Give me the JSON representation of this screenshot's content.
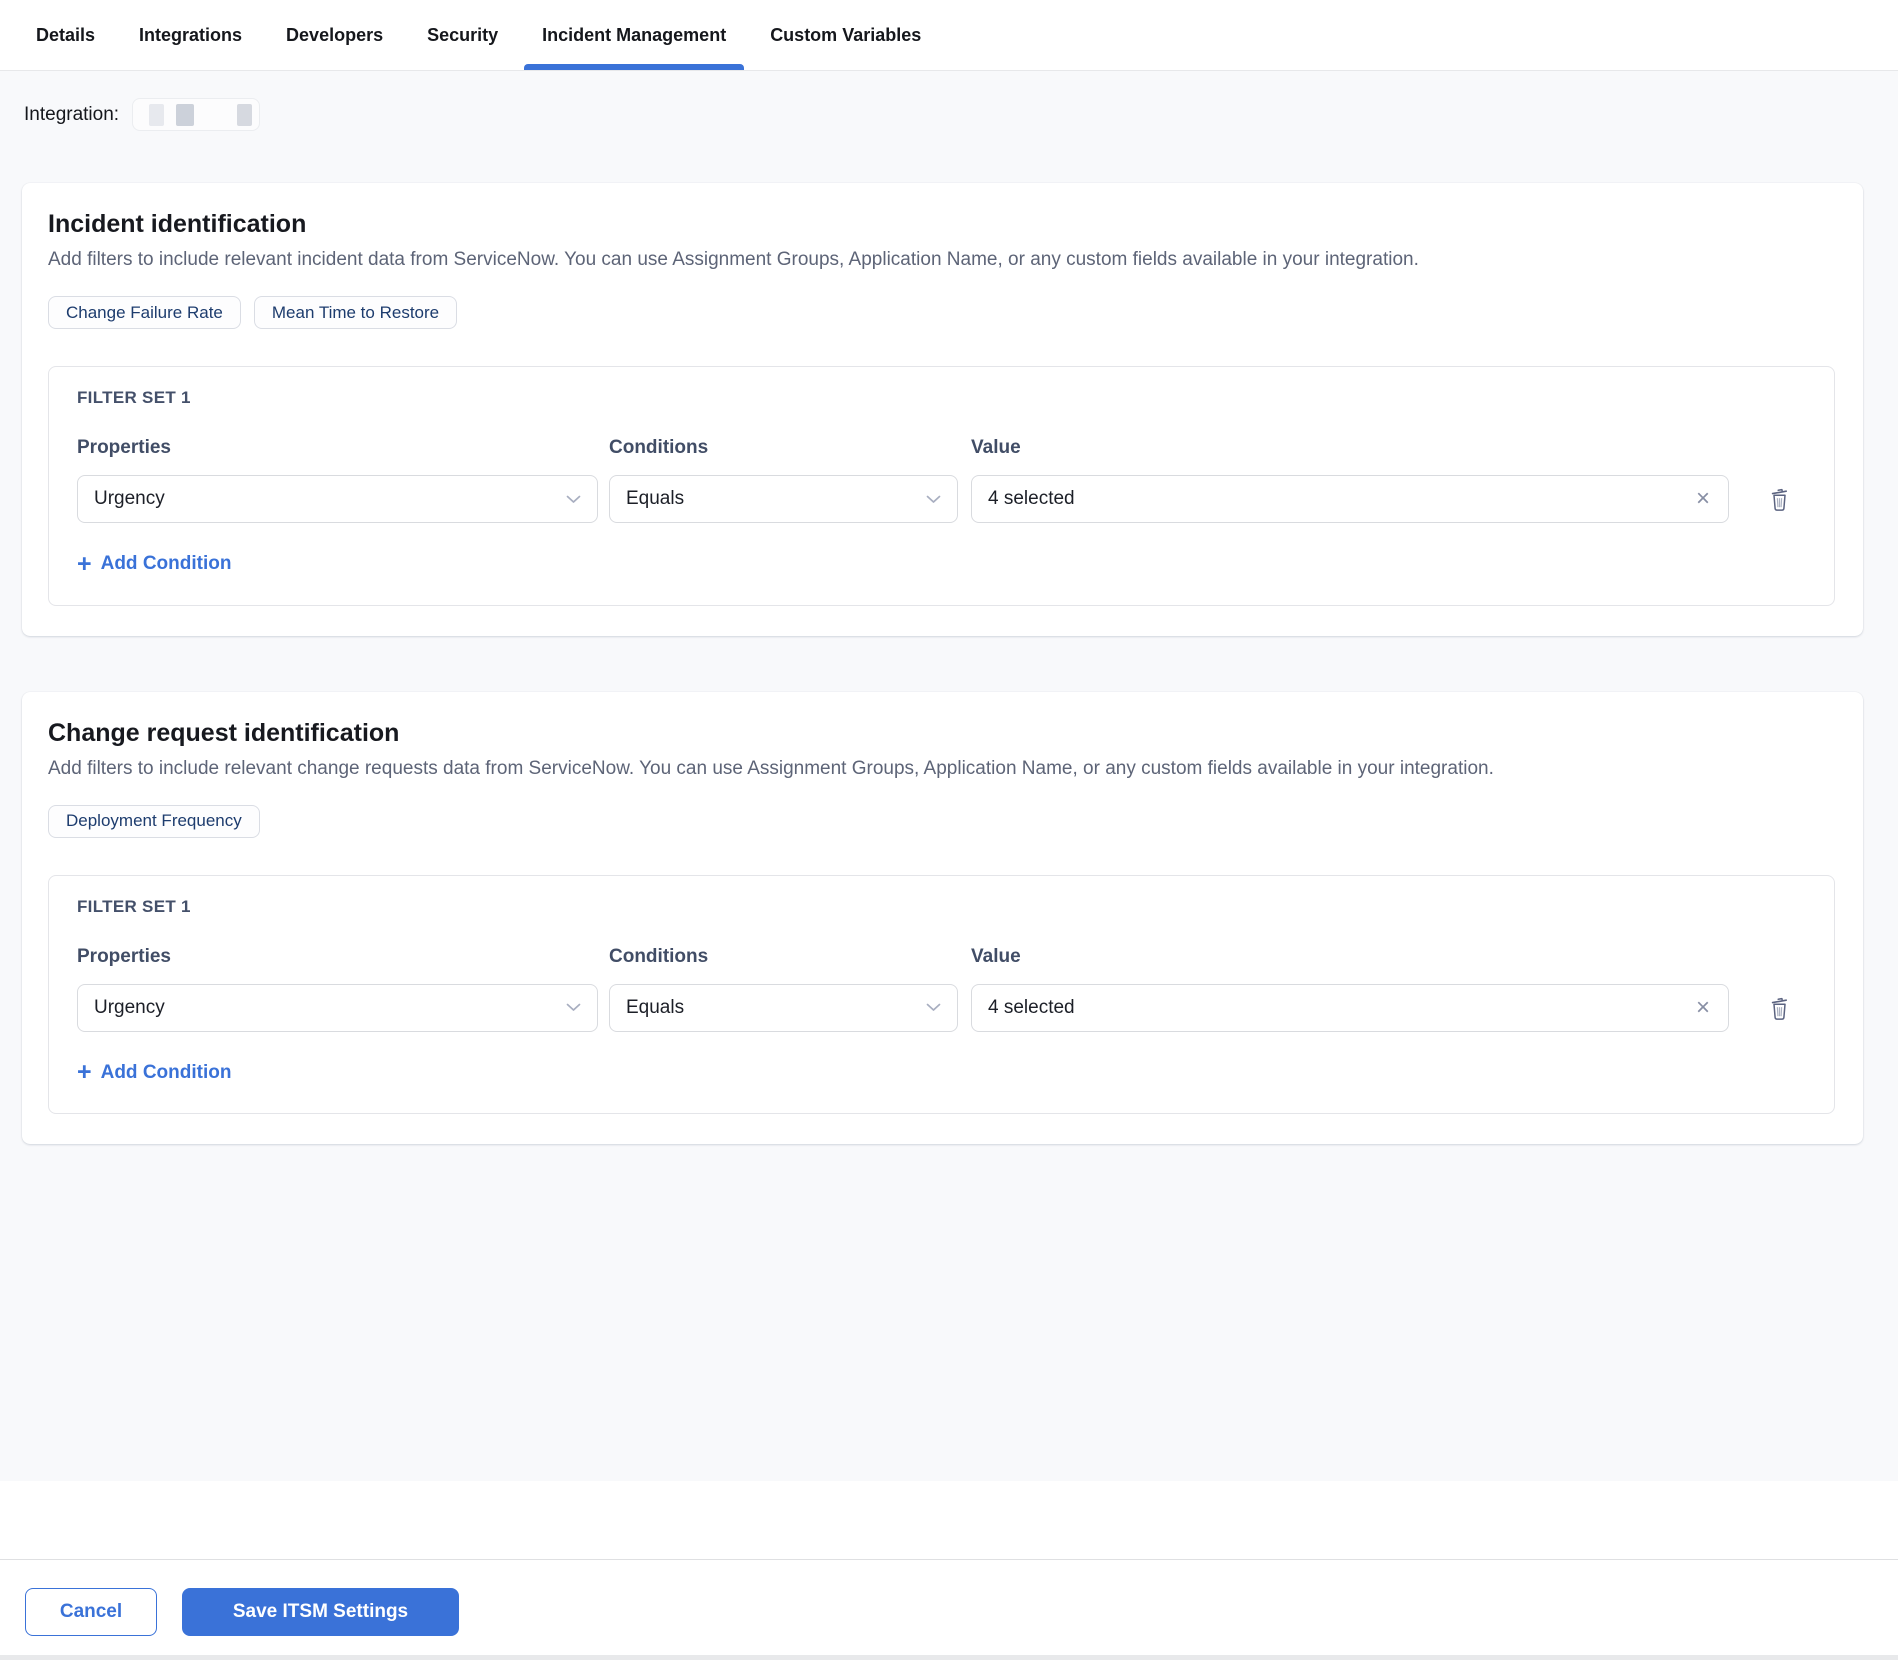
{
  "colors": {
    "accent_blue": "#3A72D8",
    "chip_text": "#1D3C6E",
    "page_background": "#F8F9FB",
    "muted_text": "#5D6477",
    "slate_heading": "#44506A"
  },
  "tab_bar": {
    "tabs": [
      {
        "label": "Details",
        "active": false
      },
      {
        "label": "Integrations",
        "active": false
      },
      {
        "label": "Developers",
        "active": false
      },
      {
        "label": "Security",
        "active": false
      },
      {
        "label": "Incident Management",
        "active": true
      },
      {
        "label": "Custom Variables",
        "active": false
      }
    ]
  },
  "integration_row": {
    "label": "Integration:",
    "value": "redacted"
  },
  "icons": {
    "add": "+",
    "clear": "×"
  },
  "sections": [
    {
      "title": "Incident identification",
      "description": "Add filters to include relevant incident data from ServiceNow. You can use Assignment Groups, Application Name, or any custom fields available in your integration.",
      "metric_chips": [
        "Change Failure Rate",
        "Mean Time to Restore"
      ],
      "filter_set": {
        "name": "FILTER SET 1",
        "column_headers": {
          "properties": "Properties",
          "conditions": "Conditions",
          "value": "Value"
        },
        "conditions": [
          {
            "property": "Urgency",
            "condition": "Equals",
            "value": "4 selected"
          }
        ],
        "add_condition_label": "Add Condition"
      }
    },
    {
      "title": "Change request identification",
      "description": "Add filters to include relevant change requests data from ServiceNow. You can use Assignment Groups, Application Name, or any custom fields available in your integration.",
      "metric_chips": [
        "Deployment Frequency"
      ],
      "filter_set": {
        "name": "FILTER SET 1",
        "column_headers": {
          "properties": "Properties",
          "conditions": "Conditions",
          "value": "Value"
        },
        "conditions": [
          {
            "property": "Urgency",
            "condition": "Equals",
            "value": "4 selected"
          }
        ],
        "add_condition_label": "Add Condition"
      }
    }
  ],
  "footer": {
    "cancel_label": "Cancel",
    "save_label": "Save ITSM Settings"
  }
}
